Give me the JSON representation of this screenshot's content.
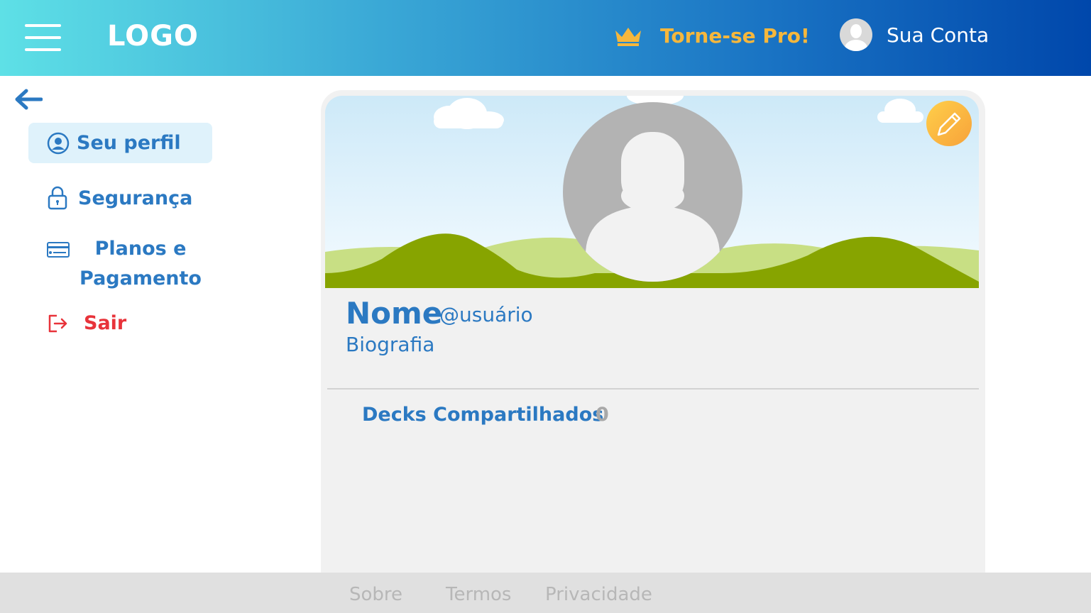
{
  "header": {
    "logo": "LOGO",
    "pro_label": "Torne-se Pro!",
    "account_label": "Sua Conta"
  },
  "sidebar": {
    "items": [
      {
        "label": "Seu perfil",
        "icon": "user-circle-icon"
      },
      {
        "label": "Segurança",
        "icon": "lock-icon"
      },
      {
        "label": "Planos e Pagamento",
        "icon": "credit-card-icon"
      },
      {
        "label": "Sair",
        "icon": "logout-icon"
      }
    ]
  },
  "profile": {
    "name": "Nome",
    "handle": "@usuário",
    "bio": "Biografia",
    "decks_label": "Decks Compartilhados",
    "decks_count": "0"
  },
  "footer": {
    "links": [
      "Sobre",
      "Termos",
      "Privacidade"
    ]
  },
  "colors": {
    "primary": "#2b79c2",
    "accent_pro": "#f6b73c",
    "danger": "#e8333a",
    "card_bg": "#f1f1f1",
    "footer_bg": "#e0e0e0"
  }
}
